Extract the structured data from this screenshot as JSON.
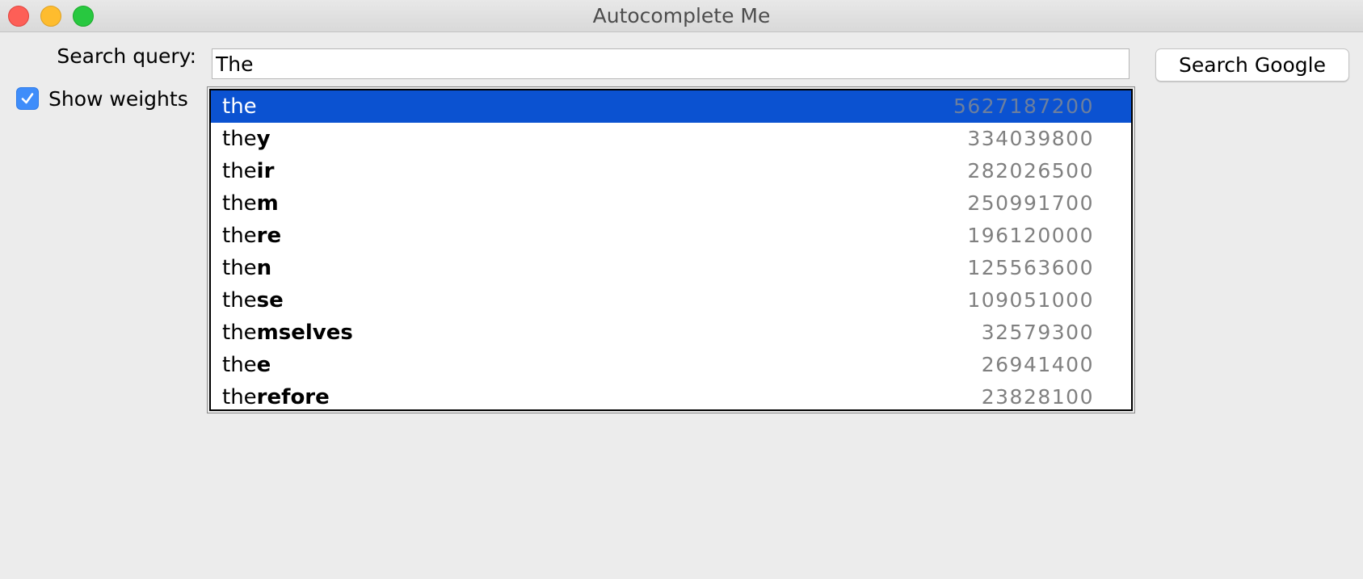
{
  "window": {
    "title": "Autocomplete Me"
  },
  "query": {
    "label": "Search query:",
    "value": "The"
  },
  "show_weights": {
    "label": "Show weights",
    "checked": true
  },
  "search_button": {
    "label": "Search Google"
  },
  "suggestions": [
    {
      "prefix": "the",
      "rest": "",
      "weight": "5627187200",
      "selected": true
    },
    {
      "prefix": "the",
      "rest": "y",
      "weight": "334039800"
    },
    {
      "prefix": "the",
      "rest": "ir",
      "weight": "282026500"
    },
    {
      "prefix": "the",
      "rest": "m",
      "weight": "250991700"
    },
    {
      "prefix": "the",
      "rest": "re",
      "weight": "196120000"
    },
    {
      "prefix": "the",
      "rest": "n",
      "weight": "125563600"
    },
    {
      "prefix": "the",
      "rest": "se",
      "weight": "109051000"
    },
    {
      "prefix": "the",
      "rest": "mselves",
      "weight": "32579300"
    },
    {
      "prefix": "the",
      "rest": "e",
      "weight": "26941400"
    },
    {
      "prefix": "the",
      "rest": "refore",
      "weight": "23828100"
    }
  ],
  "colors": {
    "selection": "#0b52d1",
    "checkbox": "#3f8dfa",
    "weight_text": "#808080"
  }
}
